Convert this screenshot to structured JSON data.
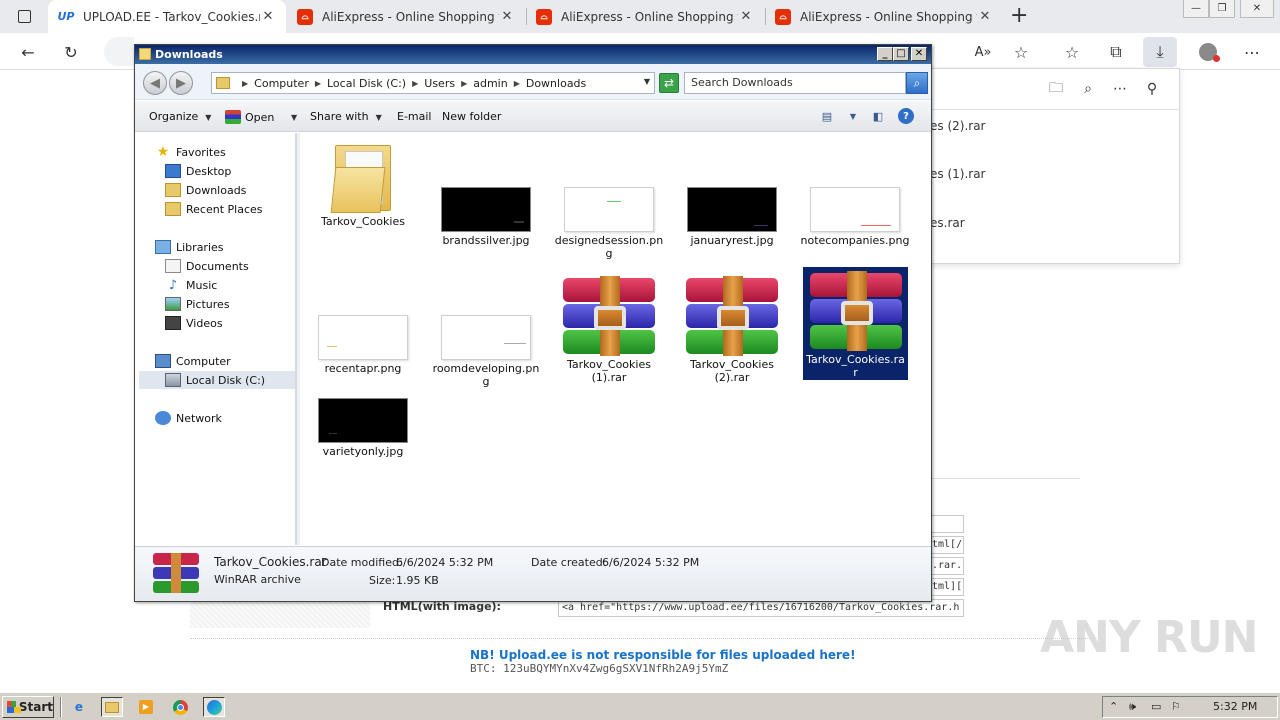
{
  "browser": {
    "tabs": [
      {
        "label": "UPLOAD.EE - Tarkov_Cookies.rar",
        "favicon": "UP",
        "active": true
      },
      {
        "label": "AliExpress - Online Shopping für",
        "favicon": "ali-icon",
        "active": false
      },
      {
        "label": "AliExpress - Online Shopping für",
        "favicon": "ali-icon",
        "active": false
      },
      {
        "label": "AliExpress - Online Shopping für",
        "favicon": "ali-icon",
        "active": false
      }
    ],
    "download_flyout": {
      "items": [
        "es (2).rar",
        "es (1).rar",
        "es.rar"
      ]
    }
  },
  "page": {
    "code_snippets": [
      "tml[/",
      ".rar.h",
      "tml]["
    ],
    "html_label": "HTML(with image):",
    "html_value": "<a href=\"https://www.upload.ee/files/16716200/Tarkov_Cookies.rar.h",
    "nb_text": "NB! Upload.ee is not responsible for files uploaded here!",
    "btc_text": "BTC: 123uBQYMYnXv4Zwg6gSXV1NfRh2A9j5YmZ",
    "watermark": "ANY RUN"
  },
  "explorer": {
    "title": "Downloads",
    "breadcrumb": [
      "Computer",
      "Local Disk (C:)",
      "Users",
      "admin",
      "Downloads"
    ],
    "search_placeholder": "Search Downloads",
    "commands": {
      "organize": "Organize",
      "open": "Open",
      "share_with": "Share with",
      "email": "E-mail",
      "new_folder": "New folder"
    },
    "nav": {
      "favorites": "Favorites",
      "desktop": "Desktop",
      "downloads": "Downloads",
      "recent_places": "Recent Places",
      "libraries": "Libraries",
      "documents": "Documents",
      "music": "Music",
      "pictures": "Pictures",
      "videos": "Videos",
      "computer": "Computer",
      "local_disk": "Local Disk (C:)",
      "network": "Network"
    },
    "files": [
      {
        "name": "Tarkov_Cookies",
        "kind": "folder"
      },
      {
        "name": "brandssilver.jpg",
        "kind": "black"
      },
      {
        "name": "designedsession.png",
        "kind": "white"
      },
      {
        "name": "januaryrest.jpg",
        "kind": "black"
      },
      {
        "name": "notecompanies.png",
        "kind": "white"
      },
      {
        "name": "recentapr.png",
        "kind": "white"
      },
      {
        "name": "roomdeveloping.png",
        "kind": "white"
      },
      {
        "name": "Tarkov_Cookies (1).rar",
        "kind": "rar"
      },
      {
        "name": "Tarkov_Cookies (2).rar",
        "kind": "rar"
      },
      {
        "name": "Tarkov_Cookies.rar",
        "kind": "rar",
        "selected": true
      },
      {
        "name": "varietyonly.jpg",
        "kind": "black"
      }
    ],
    "details": {
      "name": "Tarkov_Cookies.rar",
      "type": "WinRAR archive",
      "date_modified_label": "Date modified:",
      "date_modified": "6/6/2024 5:32 PM",
      "date_created_label": "Date created:",
      "date_created": "6/6/2024 5:32 PM",
      "size_label": "Size:",
      "size": "1.95 KB"
    }
  },
  "taskbar": {
    "start": "Start",
    "clock": "5:32 PM"
  }
}
